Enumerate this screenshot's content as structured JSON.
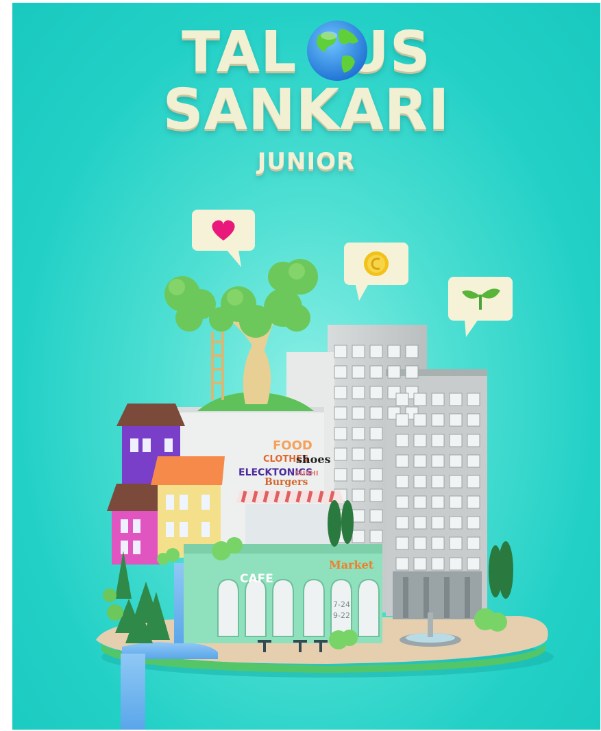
{
  "brand": {
    "title_line_1": "TALOUS",
    "title_line_2": "SANKARI",
    "subtitle": "JUNIOR"
  },
  "icons": {
    "logo_o": "globe-icon",
    "bubble_1": "heart-icon",
    "bubble_2": "coin-icon",
    "bubble_3": "sprout-icon"
  },
  "signs": {
    "food": "FOOD",
    "clothes": "CLOTHES",
    "shoes": "shoes",
    "electronics": "ELECKTONICS",
    "sushi": "SUSHI",
    "burgers": "Burgers",
    "cafe": "CAFE",
    "market": "Market",
    "hours_1": "7-24",
    "hours_2": "9-22"
  },
  "colors": {
    "background": "#22d0c6",
    "title": "#f1f0d2",
    "heart": "#e8197a",
    "coin": "#f2c21b",
    "sprout": "#59b43a"
  }
}
